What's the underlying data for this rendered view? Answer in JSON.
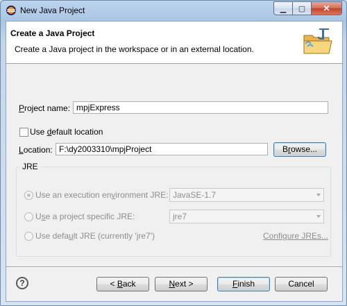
{
  "window": {
    "title": "New Java Project",
    "controls": {
      "minimize": "▁",
      "maximize": "▢",
      "close": "✕"
    }
  },
  "banner": {
    "title": "Create a Java Project",
    "description": "Create a Java project in the workspace or in an external location."
  },
  "project_name": {
    "label_prefix": "",
    "label_underlined": "P",
    "label_rest": "roject name:",
    "value": "mpjExpress"
  },
  "use_default_location": {
    "label_pre": "Use ",
    "label_underlined": "d",
    "label_rest": "efault location",
    "checked": false
  },
  "location": {
    "label_underlined": "L",
    "label_rest": "ocation:",
    "value": "F:\\dy2003310\\mpjProject",
    "browse_pre": "B",
    "browse_underlined": "r",
    "browse_rest": "owse..."
  },
  "jre": {
    "group_title": "JRE",
    "option_env": {
      "label_pre": "Use an execution en",
      "label_underlined": "v",
      "label_rest": "ironment JRE:",
      "selected": true,
      "combo_value": "JavaSE-1.7"
    },
    "option_specific": {
      "label_pre": "U",
      "label_underlined": "s",
      "label_rest": "e a project specific JRE:",
      "selected": false,
      "combo_value": "jre7"
    },
    "option_default": {
      "label_pre": "Use defa",
      "label_underlined": "u",
      "label_rest": "lt JRE (currently 'jre7')",
      "selected": false
    },
    "configure_link": "Configure JREs..."
  },
  "footer": {
    "help_icon": "?",
    "back_pre": "< ",
    "back_underlined": "B",
    "back_rest": "ack",
    "next_underlined": "N",
    "next_rest": "ext >",
    "finish_underlined": "F",
    "finish_rest": "inish",
    "cancel": "Cancel"
  }
}
